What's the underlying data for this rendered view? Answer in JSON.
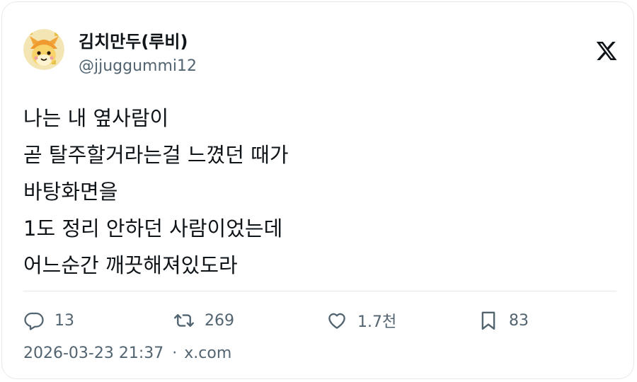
{
  "author": {
    "display_name": "김치만두(루비)",
    "handle": "@jjuggummi12",
    "avatar": "avatar-image"
  },
  "platform_logo": "x-logo-icon",
  "tweet": {
    "lines": [
      "나는 내 옆사람이",
      "곧 탈주할거라는걸 느꼈던 때가",
      "바탕화면을",
      "1도 정리 안하던 사람이었는데",
      "어느순간 깨끗해져있도라"
    ]
  },
  "actions": {
    "replies": {
      "icon": "reply-icon",
      "count": "13"
    },
    "retweets": {
      "icon": "retweet-icon",
      "count": "269"
    },
    "likes": {
      "icon": "heart-icon",
      "count": "1.7천"
    },
    "bookmarks": {
      "icon": "bookmark-icon",
      "count": "83"
    }
  },
  "meta": {
    "timestamp": "2026-03-23 21:37",
    "separator": "·",
    "source": "x.com"
  },
  "colors": {
    "text_primary": "#0f1419",
    "text_secondary": "#536471",
    "border": "#e6e9ec"
  }
}
